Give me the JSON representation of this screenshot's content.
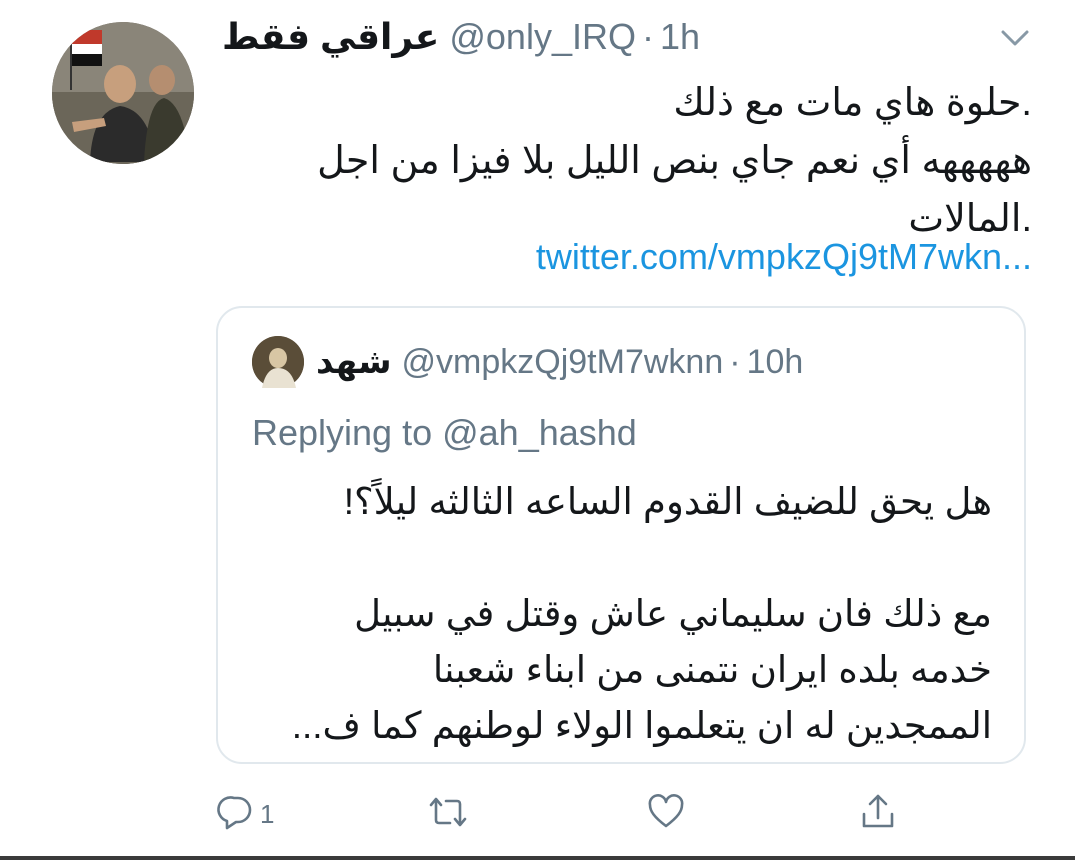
{
  "tweet": {
    "display_name": "عراقي فقط",
    "handle": "@only_IRQ",
    "separator": "·",
    "time": "1h",
    "text_lines": [
      ".حلوة هاي مات مع ذلك",
      "هههههه أي نعم جاي بنص الليل بلا فيزا من اجل",
      ".المالات"
    ],
    "link": "twitter.com/vmpkzQj9tM7wkn..."
  },
  "quoted_tweet": {
    "display_name": "شهد",
    "handle": "@vmpkzQj9tM7wknn",
    "separator": "·",
    "time": "10h",
    "replying_to": "Replying to @ah_hashd",
    "paragraph_1": "هل يحق للضيف القدوم الساعه الثالثه ليلاً؟!",
    "paragraph_2_lines": [
      "مع ذلك فان سليماني عاش وقتل في سبيل",
      "خدمه بلده ايران نتمنى من ابناء شعبنا",
      "الممجدين له ان يتعلموا الولاء لوطنهم كما ف..."
    ]
  },
  "actions": {
    "reply": {
      "icon": "reply-icon",
      "count": "1"
    },
    "retweet": {
      "icon": "retweet-icon"
    },
    "like": {
      "icon": "heart-icon"
    },
    "share": {
      "icon": "share-icon"
    }
  },
  "colors": {
    "text": "#14171a",
    "muted": "#657786",
    "link": "#1b95e0",
    "border": "#e1e8ed"
  }
}
